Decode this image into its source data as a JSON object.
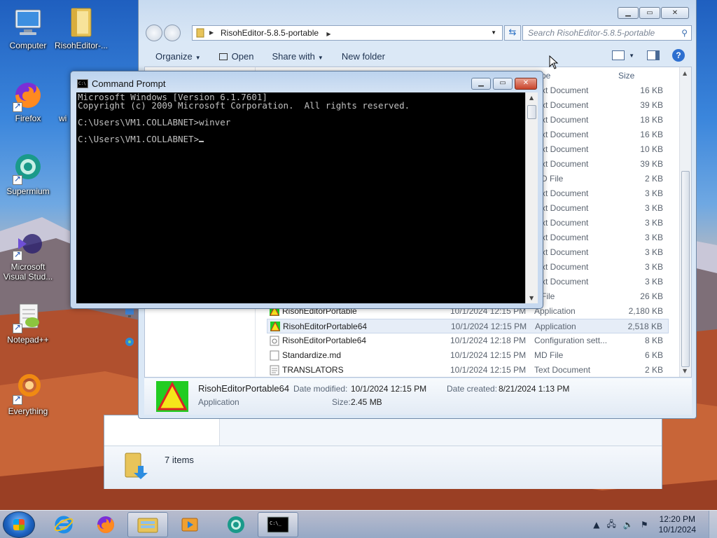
{
  "desktop": {
    "icons": [
      {
        "label": "Computer",
        "icon": "computer-icon"
      },
      {
        "label": "RisohEditor-...",
        "icon": "folder-icon"
      },
      {
        "label": "Firefox",
        "icon": "firefox-icon"
      },
      {
        "label": "wi",
        "icon": "partial-icon"
      },
      {
        "label": "Supermium",
        "icon": "supermium-icon"
      },
      {
        "label": "Microsoft Visual Stud...",
        "icon": "visual-studio-icon"
      },
      {
        "label": "Notepad++",
        "icon": "notepadpp-icon"
      },
      {
        "label": "Everything",
        "icon": "everything-icon"
      }
    ]
  },
  "explorer": {
    "address_path": "RisohEditor-5.8.5-portable",
    "search_placeholder": "Search RisohEditor-5.8.5-portable",
    "toolbar": {
      "organize": "Organize",
      "open": "Open",
      "share_with": "Share with",
      "new_folder": "New folder"
    },
    "columns": {
      "type": "pe",
      "size": "Size"
    },
    "partial_rows": [
      {
        "type": "xt Document",
        "size": "16 KB"
      },
      {
        "type": "xt Document",
        "size": "39 KB"
      },
      {
        "type": "xt Document",
        "size": "18 KB"
      },
      {
        "type": "xt Document",
        "size": "16 KB"
      },
      {
        "type": "xt Document",
        "size": "10 KB"
      },
      {
        "type": "xt Document",
        "size": "39 KB"
      },
      {
        "type": "D File",
        "size": "2 KB"
      },
      {
        "type": "xt Document",
        "size": "3 KB"
      },
      {
        "type": "xt Document",
        "size": "3 KB"
      },
      {
        "type": "xt Document",
        "size": "3 KB"
      },
      {
        "type": "xt Document",
        "size": "3 KB"
      },
      {
        "type": "xt Document",
        "size": "3 KB"
      },
      {
        "type": "xt Document",
        "size": "3 KB"
      },
      {
        "type": "xt Document",
        "size": "3 KB"
      },
      {
        "type": "File",
        "size": "26 KB"
      }
    ],
    "rows": [
      {
        "name": "RisohEditorPortable",
        "date": "10/1/2024 12:15 PM",
        "type": "Application",
        "size": "2,180 KB",
        "icon": "app-icon"
      },
      {
        "name": "RisohEditorPortable64",
        "date": "10/1/2024 12:15 PM",
        "type": "Application",
        "size": "2,518 KB",
        "icon": "app-icon"
      },
      {
        "name": "RisohEditorPortable64",
        "date": "10/1/2024 12:18 PM",
        "type": "Configuration sett...",
        "size": "8 KB",
        "icon": "config-file-icon"
      },
      {
        "name": "Standardize.md",
        "date": "10/1/2024 12:15 PM",
        "type": "MD File",
        "size": "6 KB",
        "icon": "file-icon"
      },
      {
        "name": "TRANSLATORS",
        "date": "10/1/2024 12:15 PM",
        "type": "Text Document",
        "size": "2 KB",
        "icon": "text-file-icon"
      }
    ],
    "selected_row": 1,
    "details": {
      "name": "RisohEditorPortable64",
      "kind": "Application",
      "date_modified_label": "Date modified:",
      "date_modified": "10/1/2024 12:15 PM",
      "date_created_label": "Date created:",
      "date_created": "8/21/2024 1:13 PM",
      "size_label": "Size:",
      "size": "2.45 MB"
    }
  },
  "back_window": {
    "item_count": "7 items"
  },
  "cmd": {
    "title": "Command Prompt",
    "lines": [
      "Microsoft Windows [Version 6.1.7601]",
      "Copyright (c) 2009 Microsoft Corporation.  All rights reserved.",
      "",
      "C:\\Users\\VM1.COLLABNET>winver",
      "",
      "C:\\Users\\VM1.COLLABNET>"
    ]
  },
  "taskbar": {
    "time": "12:20 PM",
    "date": "10/1/2024",
    "apps": [
      "internet-explorer-icon",
      "firefox-icon",
      "explorer-icon",
      "media-player-icon",
      "supermium-icon",
      "cmd-icon"
    ]
  },
  "colors": {
    "accent": "#2d6fd0",
    "selection": "#e6edf7",
    "console_bg": "#000000",
    "console_fg": "#c0c0c0"
  }
}
